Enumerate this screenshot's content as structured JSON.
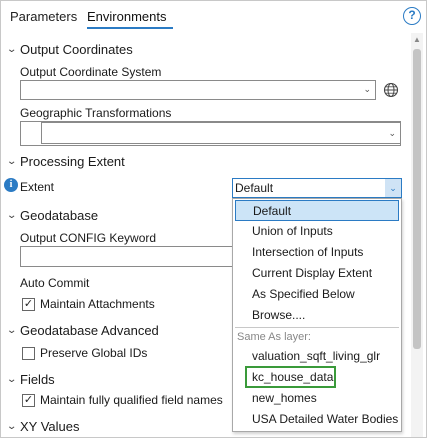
{
  "tabs": [
    {
      "label": "Parameters"
    },
    {
      "label": "Environments"
    }
  ],
  "help_icon_glyph": "?",
  "sections": {
    "output_coordinates": "Output Coordinates",
    "processing_extent": "Processing Extent",
    "geodatabase": "Geodatabase",
    "geodatabase_advanced": "Geodatabase Advanced",
    "fields": "Fields",
    "xy_values": "XY Values"
  },
  "output_coordinates": {
    "coordinate_system_label": "Output Coordinate System",
    "coordinate_system_value": "",
    "transformations_label": "Geographic Transformations",
    "transformations_value": ""
  },
  "processing_extent": {
    "extent_label": "Extent",
    "extent_value": "Default",
    "options": [
      "Default",
      "Union of Inputs",
      "Intersection of Inputs",
      "Current Display Extent",
      "As Specified Below",
      "Browse...."
    ],
    "layer_group_header": "Same As layer:",
    "layers": [
      "valuation_sqft_living_glr",
      "kc_house_data",
      "new_homes",
      "USA Detailed Water Bodies"
    ],
    "selected_option": "Default",
    "highlighted_layer": "kc_house_data"
  },
  "geodatabase": {
    "config_keyword_label": "Output CONFIG Keyword",
    "config_keyword_value": "",
    "auto_commit_label": "Auto Commit",
    "maintain_attachments_label": "Maintain Attachments",
    "maintain_attachments_checked": true
  },
  "geodatabase_advanced": {
    "preserve_global_ids_label": "Preserve Global IDs",
    "preserve_global_ids_checked": false
  },
  "fields": {
    "maintain_field_names_label": "Maintain fully qualified field names",
    "maintain_field_names_checked": true
  },
  "icons": {
    "help": "help-icon",
    "info": "info-icon",
    "globe": "globe-icon",
    "chevron": "chevron-down-icon",
    "check": "check-icon"
  },
  "colors": {
    "accent": "#2b7bc4",
    "selection_bg": "#cce4f7",
    "highlight_border": "#3a9a3a"
  },
  "glyphs": {
    "check": "✓",
    "dd_arrow": "⌄",
    "info": "i"
  }
}
